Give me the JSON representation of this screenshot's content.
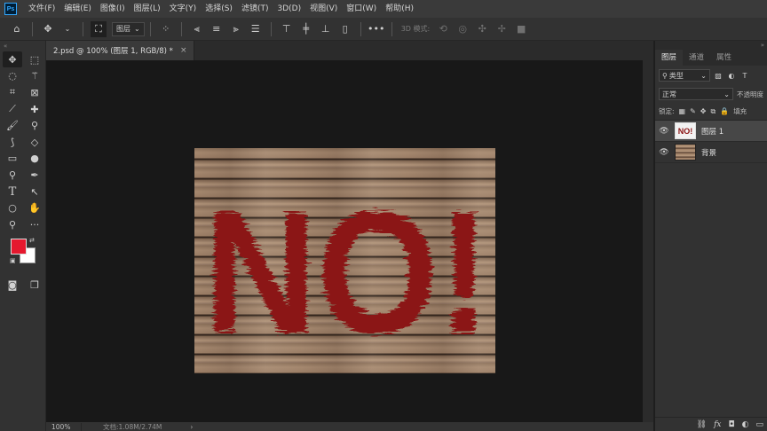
{
  "app": {
    "logo": "Ps"
  },
  "menu": [
    "文件(F)",
    "编辑(E)",
    "图像(I)",
    "图层(L)",
    "文字(Y)",
    "选择(S)",
    "滤镜(T)",
    "3D(D)",
    "视图(V)",
    "窗口(W)",
    "帮助(H)"
  ],
  "options": {
    "auto_select_target": "图层",
    "mode_3d_label": "3D 模式:"
  },
  "document": {
    "tab_title": "2.psd @ 100% (图层 1, RGB/8) *",
    "zoom": "100%",
    "doc_size": "文档:1.08M/2.74M"
  },
  "artwork": {
    "text": "NO!",
    "paint_color": "#8b1414"
  },
  "colors": {
    "foreground": "#e5182e",
    "background": "#ffffff"
  },
  "panel": {
    "tabs": [
      "图层",
      "通道",
      "属性"
    ],
    "filter_kind": "类型",
    "blend_mode": "正常",
    "opacity_label": "不透明度",
    "lock_label": "锁定:",
    "fill_label": "填充",
    "layers": [
      {
        "name": "图层 1",
        "thumb_text": "NO!",
        "selected": true
      },
      {
        "name": "背景",
        "thumb_text": "",
        "selected": false
      }
    ]
  }
}
